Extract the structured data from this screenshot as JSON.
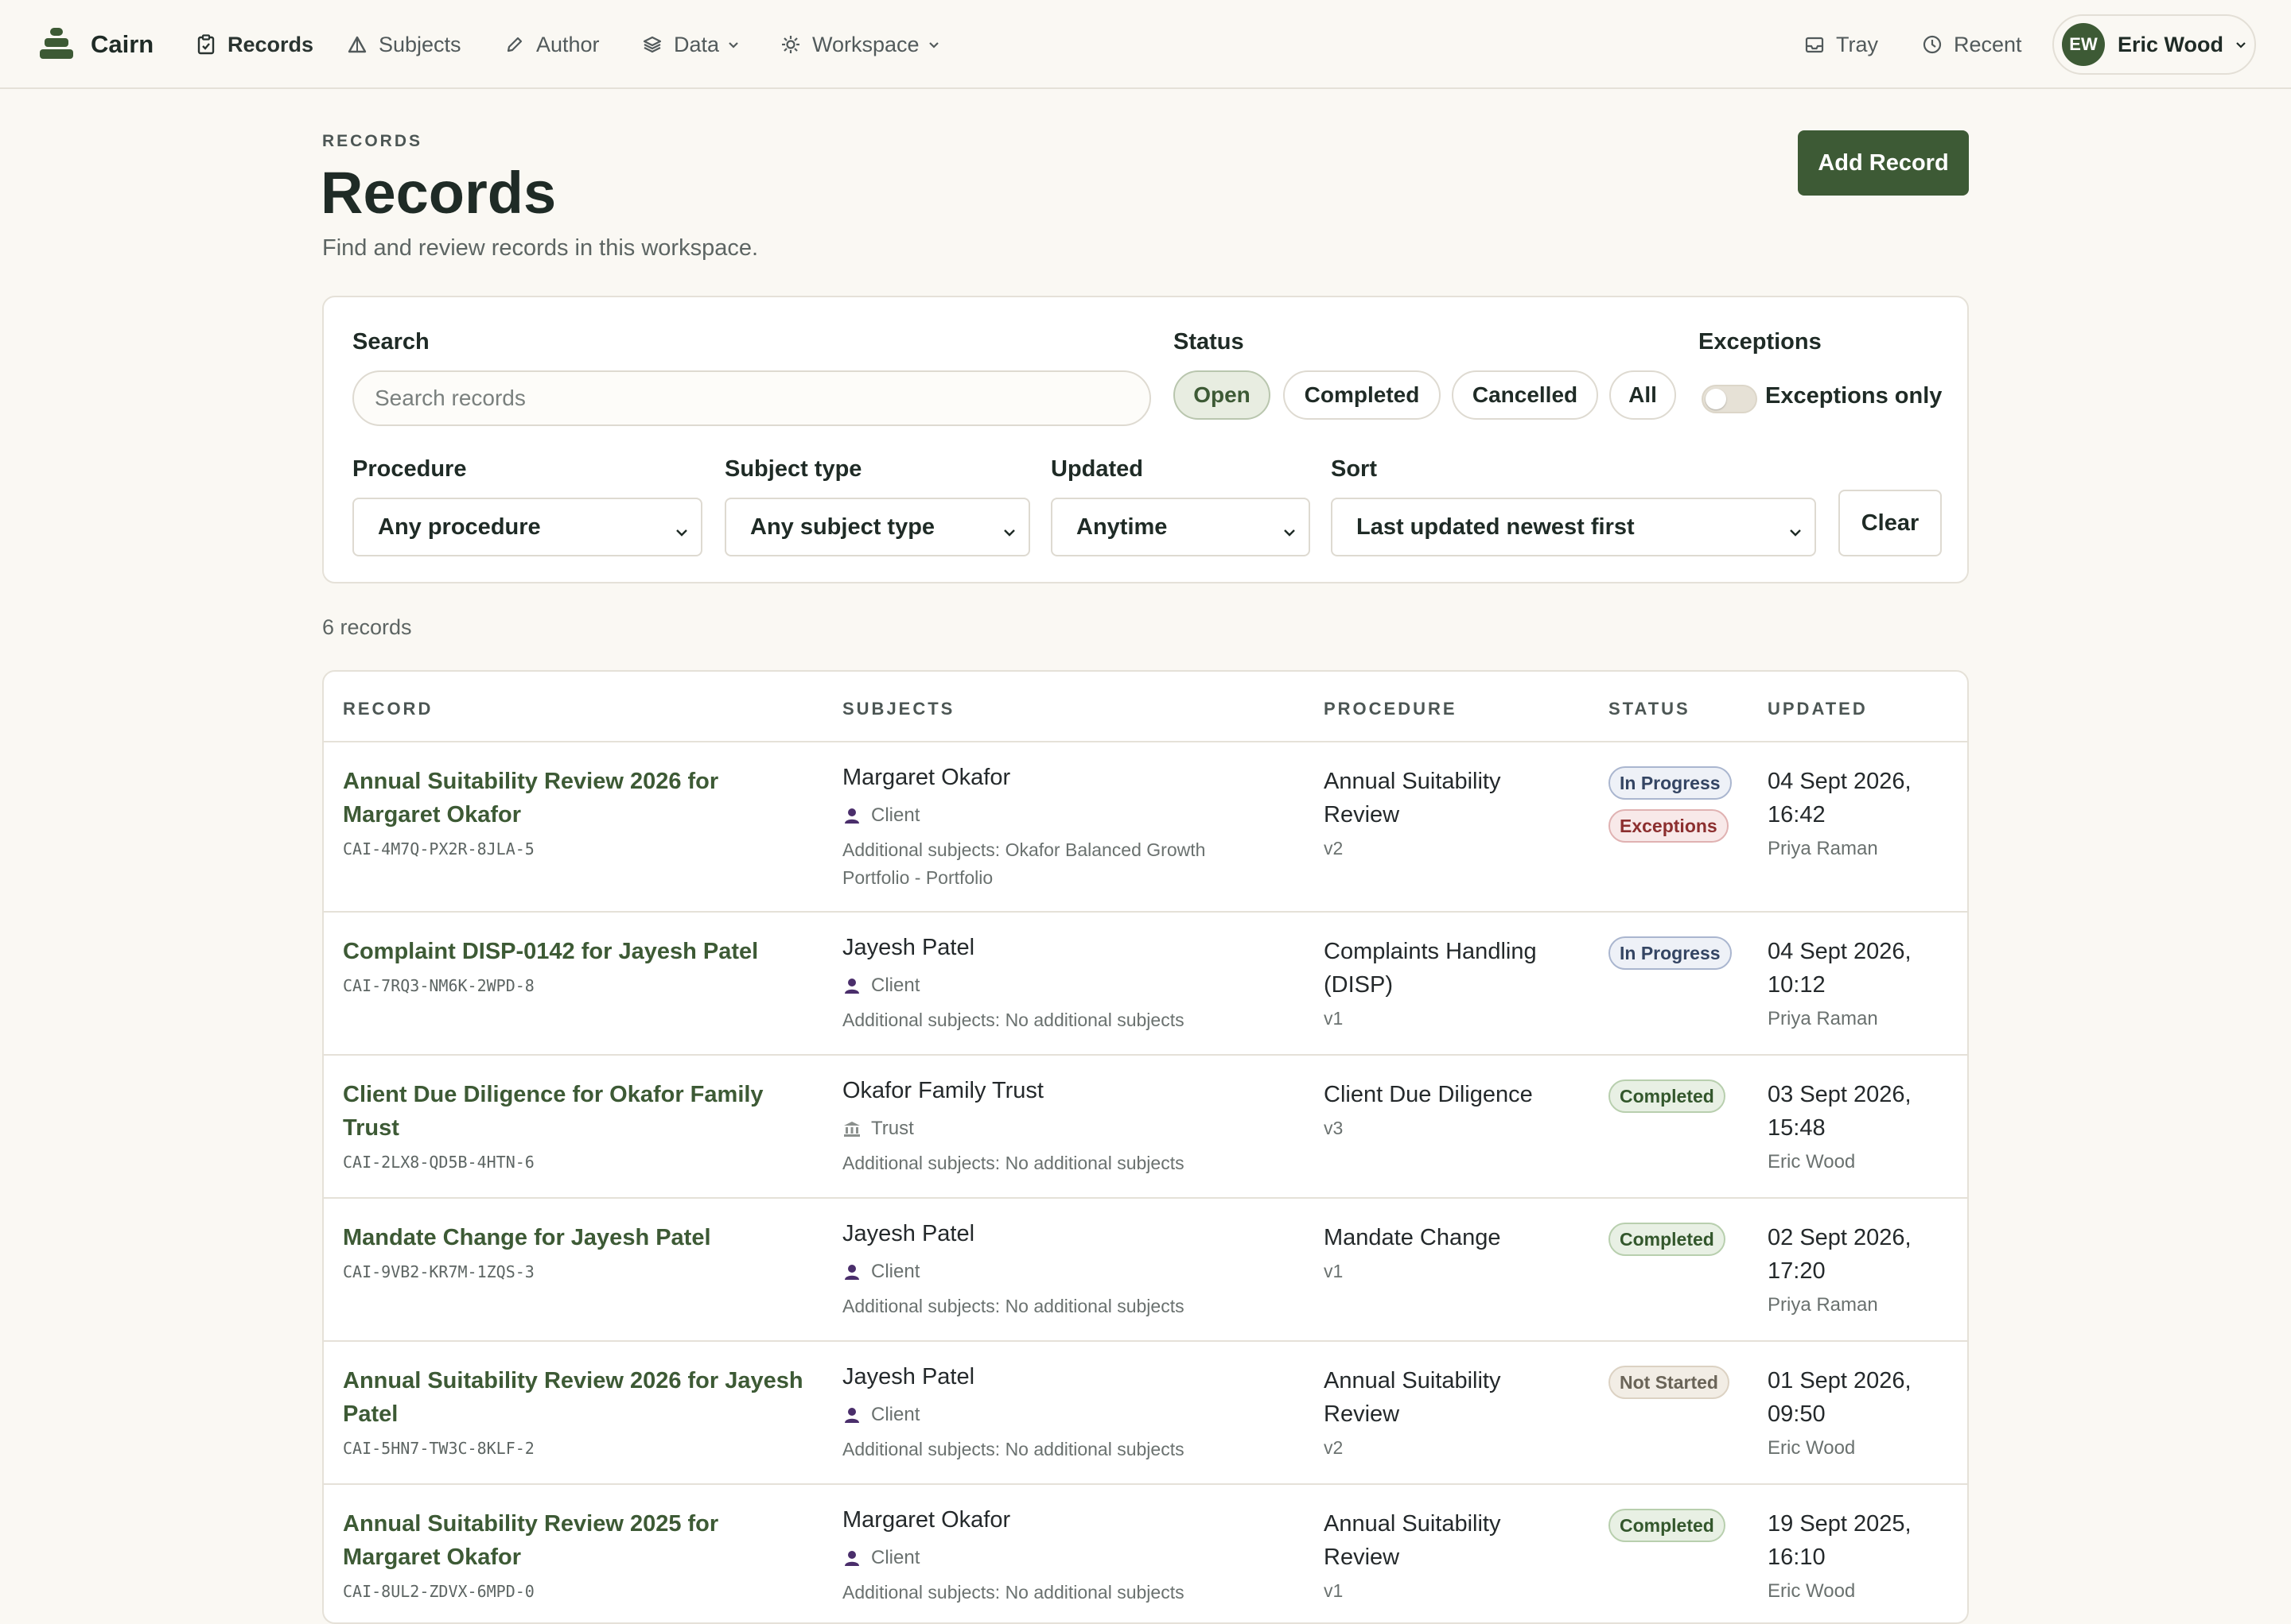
{
  "nav": {
    "brand": "Cairn",
    "links": [
      {
        "label": "Records",
        "icon": "clipboard-icon",
        "active": true
      },
      {
        "label": "Subjects",
        "icon": "triangle-icon"
      },
      {
        "label": "Author",
        "icon": "pencil-icon"
      },
      {
        "label": "Data",
        "icon": "layers-icon",
        "dropdown": true
      },
      {
        "label": "Workspace",
        "icon": "gear-icon",
        "dropdown": true
      }
    ],
    "tray": "Tray",
    "recent": "Recent",
    "user": {
      "initials": "EW",
      "name": "Eric Wood"
    }
  },
  "header": {
    "eyebrow": "RECORDS",
    "title": "Records",
    "subtitle": "Find and review records in this workspace.",
    "add_label": "Add Record"
  },
  "filters": {
    "search_label": "Search",
    "search_placeholder": "Search records",
    "status_label": "Status",
    "status_options": [
      "Open",
      "Completed",
      "Cancelled",
      "All"
    ],
    "status_selected": "Open",
    "exceptions_label": "Exceptions",
    "exceptions_toggle_label": "Exceptions only",
    "exceptions_on": false,
    "procedure_label": "Procedure",
    "procedure_value": "Any procedure",
    "subject_type_label": "Subject type",
    "subject_type_value": "Any subject type",
    "updated_label": "Updated",
    "updated_value": "Anytime",
    "sort_label": "Sort",
    "sort_value": "Last updated newest first",
    "clear_label": "Clear"
  },
  "count": "6 records",
  "table": {
    "headers": [
      "RECORD",
      "SUBJECTS",
      "PROCEDURE",
      "STATUS",
      "UPDATED"
    ],
    "rows": [
      {
        "title": "Annual Suitability Review 2026 for Margaret Okafor",
        "id": "CAI-4M7Q-PX2R-8JLA-5",
        "subject": "Margaret Okafor",
        "subject_type": "Client",
        "additional": "Additional subjects: Okafor Balanced Growth Portfolio - Portfolio",
        "procedure": "Annual Suitability Review",
        "version": "v2",
        "badges": [
          {
            "label": "In Progress",
            "kind": "inprogress"
          },
          {
            "label": "Exceptions",
            "kind": "exceptions"
          }
        ],
        "date": "04 Sept 2026, 16:42",
        "by": "Priya Raman"
      },
      {
        "title": "Complaint DISP-0142 for Jayesh Patel",
        "id": "CAI-7RQ3-NM6K-2WPD-8",
        "subject": "Jayesh Patel",
        "subject_type": "Client",
        "additional": "Additional subjects: No additional subjects",
        "procedure": "Complaints Handling (DISP)",
        "version": "v1",
        "badges": [
          {
            "label": "In Progress",
            "kind": "inprogress"
          }
        ],
        "date": "04 Sept 2026, 10:12",
        "by": "Priya Raman"
      },
      {
        "title": "Client Due Diligence for Okafor Family Trust",
        "id": "CAI-2LX8-QD5B-4HTN-6",
        "subject": "Okafor Family Trust",
        "subject_type": "Trust",
        "additional": "Additional subjects: No additional subjects",
        "procedure": "Client Due Diligence",
        "version": "v3",
        "badges": [
          {
            "label": "Completed",
            "kind": "completed"
          }
        ],
        "date": "03 Sept 2026, 15:48",
        "by": "Eric Wood"
      },
      {
        "title": "Mandate Change for Jayesh Patel",
        "id": "CAI-9VB2-KR7M-1ZQS-3",
        "subject": "Jayesh Patel",
        "subject_type": "Client",
        "additional": "Additional subjects: No additional subjects",
        "procedure": "Mandate Change",
        "version": "v1",
        "badges": [
          {
            "label": "Completed",
            "kind": "completed"
          }
        ],
        "date": "02 Sept 2026, 17:20",
        "by": "Priya Raman"
      },
      {
        "title": "Annual Suitability Review 2026 for Jayesh Patel",
        "id": "CAI-5HN7-TW3C-8KLF-2",
        "subject": "Jayesh Patel",
        "subject_type": "Client",
        "additional": "Additional subjects: No additional subjects",
        "procedure": "Annual Suitability Review",
        "version": "v2",
        "badges": [
          {
            "label": "Not Started",
            "kind": "notstarted"
          }
        ],
        "date": "01 Sept 2026, 09:50",
        "by": "Eric Wood"
      },
      {
        "title": "Annual Suitability Review 2025 for Margaret Okafor",
        "id": "CAI-8UL2-ZDVX-6MPD-0",
        "subject": "Margaret Okafor",
        "subject_type": "Client",
        "additional": "Additional subjects: No additional subjects",
        "procedure": "Annual Suitability Review",
        "version": "v1",
        "badges": [
          {
            "label": "Completed",
            "kind": "completed"
          }
        ],
        "date": "19 Sept 2025, 16:10",
        "by": "Eric Wood"
      }
    ]
  },
  "colors": {
    "accent": "#3d5a35",
    "background": "#faf8f3",
    "border": "#e5e1d8"
  }
}
